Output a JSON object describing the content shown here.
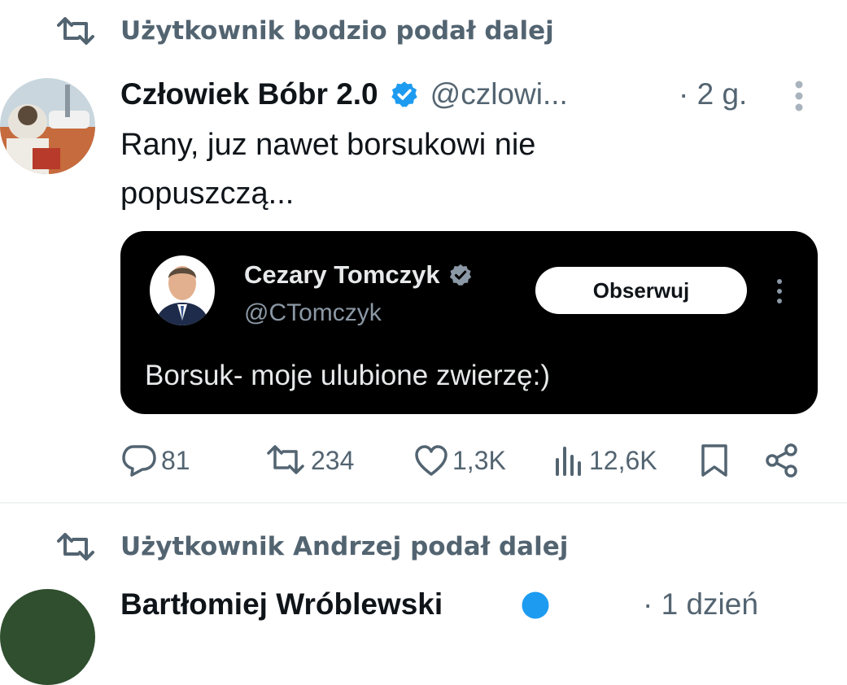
{
  "retweet1": {
    "text": "Użytkownik bodzio podał dalej"
  },
  "tweet": {
    "author_name": "Człowiek Bóbr 2.0",
    "handle": "@czlowi...",
    "time": "· 2 g.",
    "text": "Rany, juz nawet borsukowi nie popuszczą...",
    "verified": true
  },
  "embedded": {
    "author_name": "Cezary Tomczyk",
    "handle": "@CTomczyk",
    "follow_label": "Obserwuj",
    "text": "Borsuk- moje ulubione zwierzę:)"
  },
  "actions": {
    "replies": "81",
    "reposts": "234",
    "likes": "1,3K",
    "views": "12,6K"
  },
  "retweet2": {
    "text": "Użytkownik Andrzej podał dalej"
  },
  "next_tweet": {
    "author_name": "Bartłomiej Wróblewski",
    "time": "· 1 dzień"
  },
  "colors": {
    "verified": "#1d9bf0",
    "muted": "#536471",
    "card_bg": "#000000"
  },
  "icons": [
    "retweet-icon",
    "verified-badge-icon",
    "more-vertical-icon",
    "reply-icon",
    "like-icon",
    "views-icon",
    "bookmark-icon",
    "share-icon"
  ]
}
